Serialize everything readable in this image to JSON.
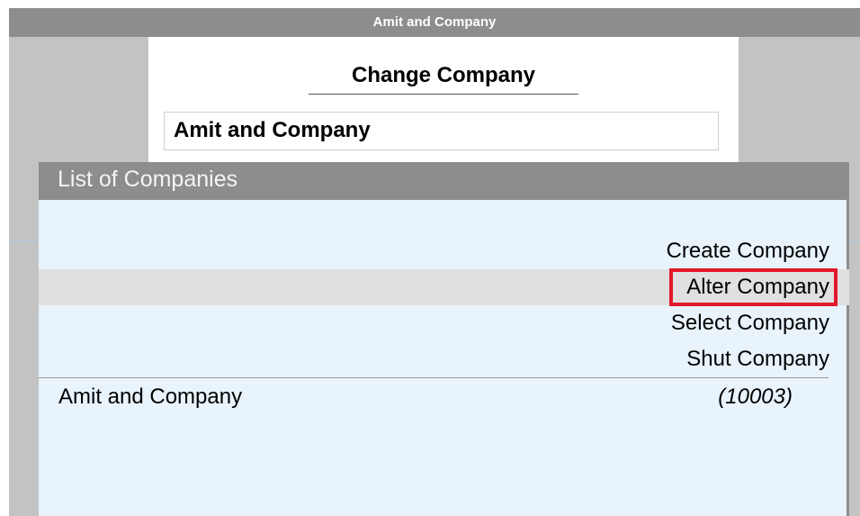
{
  "window": {
    "title": "Amit and Company"
  },
  "change_company": {
    "title": "Change Company",
    "field_value": "Amit and Company"
  },
  "list": {
    "header": "List of Companies",
    "menu_items": [
      {
        "label": "Create Company",
        "highlighted": false,
        "boxed": false
      },
      {
        "label": "Alter Company",
        "highlighted": true,
        "boxed": true
      },
      {
        "label": "Select Company",
        "highlighted": false,
        "boxed": false
      },
      {
        "label": "Shut Company",
        "highlighted": false,
        "boxed": false
      }
    ],
    "companies": [
      {
        "name": "Amit and Company",
        "number": "(10003)"
      }
    ]
  },
  "colors": {
    "title_bar": "#8d8d8d",
    "list_background": "#e8f3fc",
    "highlight_row": "#e0e0e0",
    "annotation_box": "#e2192b"
  }
}
